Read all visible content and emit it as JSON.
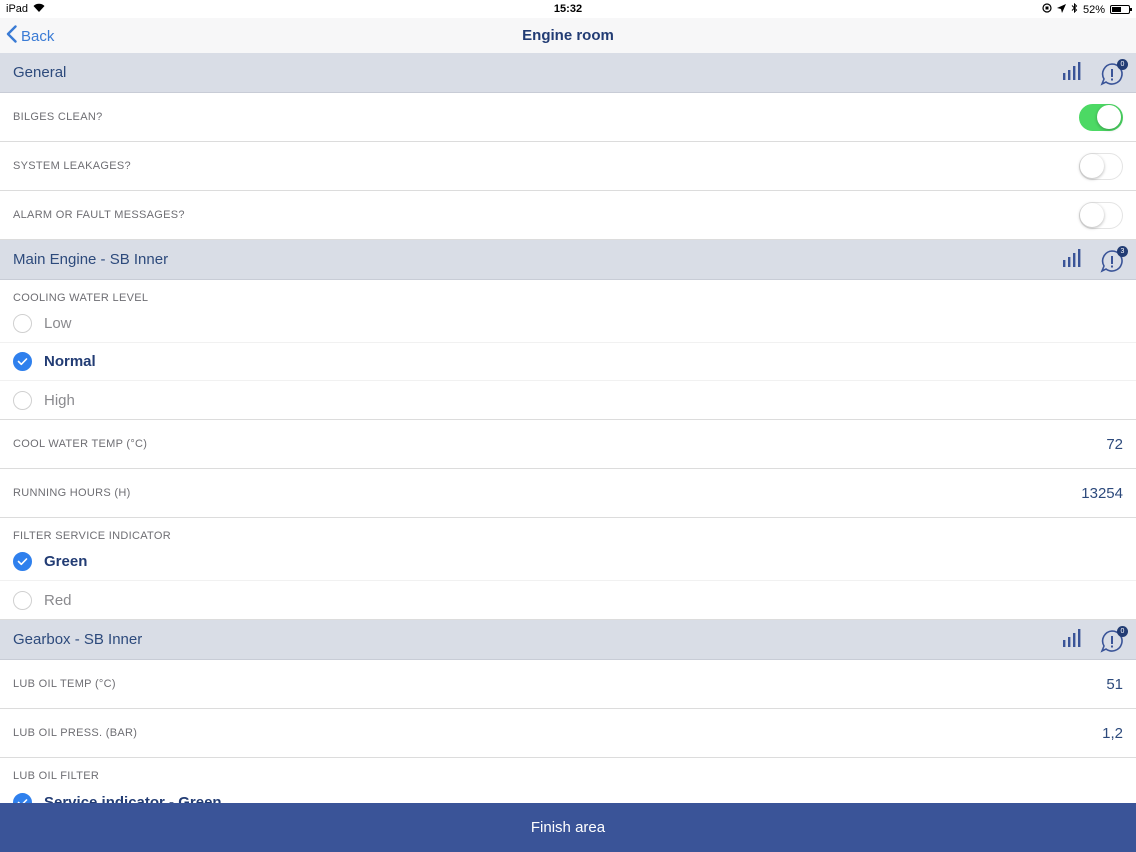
{
  "status_bar": {
    "device": "iPad",
    "time": "15:32",
    "battery": "52%"
  },
  "nav": {
    "back_label": "Back",
    "title": "Engine room"
  },
  "sections": {
    "general": {
      "title": "General",
      "alert_count": "0",
      "rows": {
        "bilges": {
          "label": "BILGES CLEAN?",
          "on": true
        },
        "leakages": {
          "label": "SYSTEM LEAKAGES?",
          "on": false
        },
        "alarm": {
          "label": "ALARM OR FAULT MESSAGES?",
          "on": false
        }
      }
    },
    "main_engine": {
      "title": "Main Engine - SB Inner",
      "alert_count": "3",
      "cooling_level": {
        "label": "COOLING WATER LEVEL",
        "options": [
          "Low",
          "Normal",
          "High"
        ],
        "selected": "Normal"
      },
      "cool_temp": {
        "label": "COOL WATER TEMP (°C)",
        "value": "72"
      },
      "running_hours": {
        "label": "RUNNING HOURS (H)",
        "value": "13254"
      },
      "filter_indicator": {
        "label": "FILTER SERVICE INDICATOR",
        "options": [
          "Green",
          "Red"
        ],
        "selected": "Green"
      }
    },
    "gearbox": {
      "title": "Gearbox - SB Inner",
      "alert_count": "0",
      "lub_temp": {
        "label": "LUB OIL TEMP (°C)",
        "value": "51"
      },
      "lub_press": {
        "label": "LUB OIL PRESS. (BAR)",
        "value": "1,2"
      },
      "lub_filter": {
        "label": "LUB OIL FILTER",
        "options": [
          "Service indicator - Green"
        ],
        "selected": "Service indicator - Green"
      }
    }
  },
  "footer": {
    "finish_label": "Finish area"
  },
  "colors": {
    "header_bg": "#d9dde6",
    "accent": "#2f80ed",
    "toggle_on": "#4cd964",
    "footer_bg": "#3a5498"
  }
}
